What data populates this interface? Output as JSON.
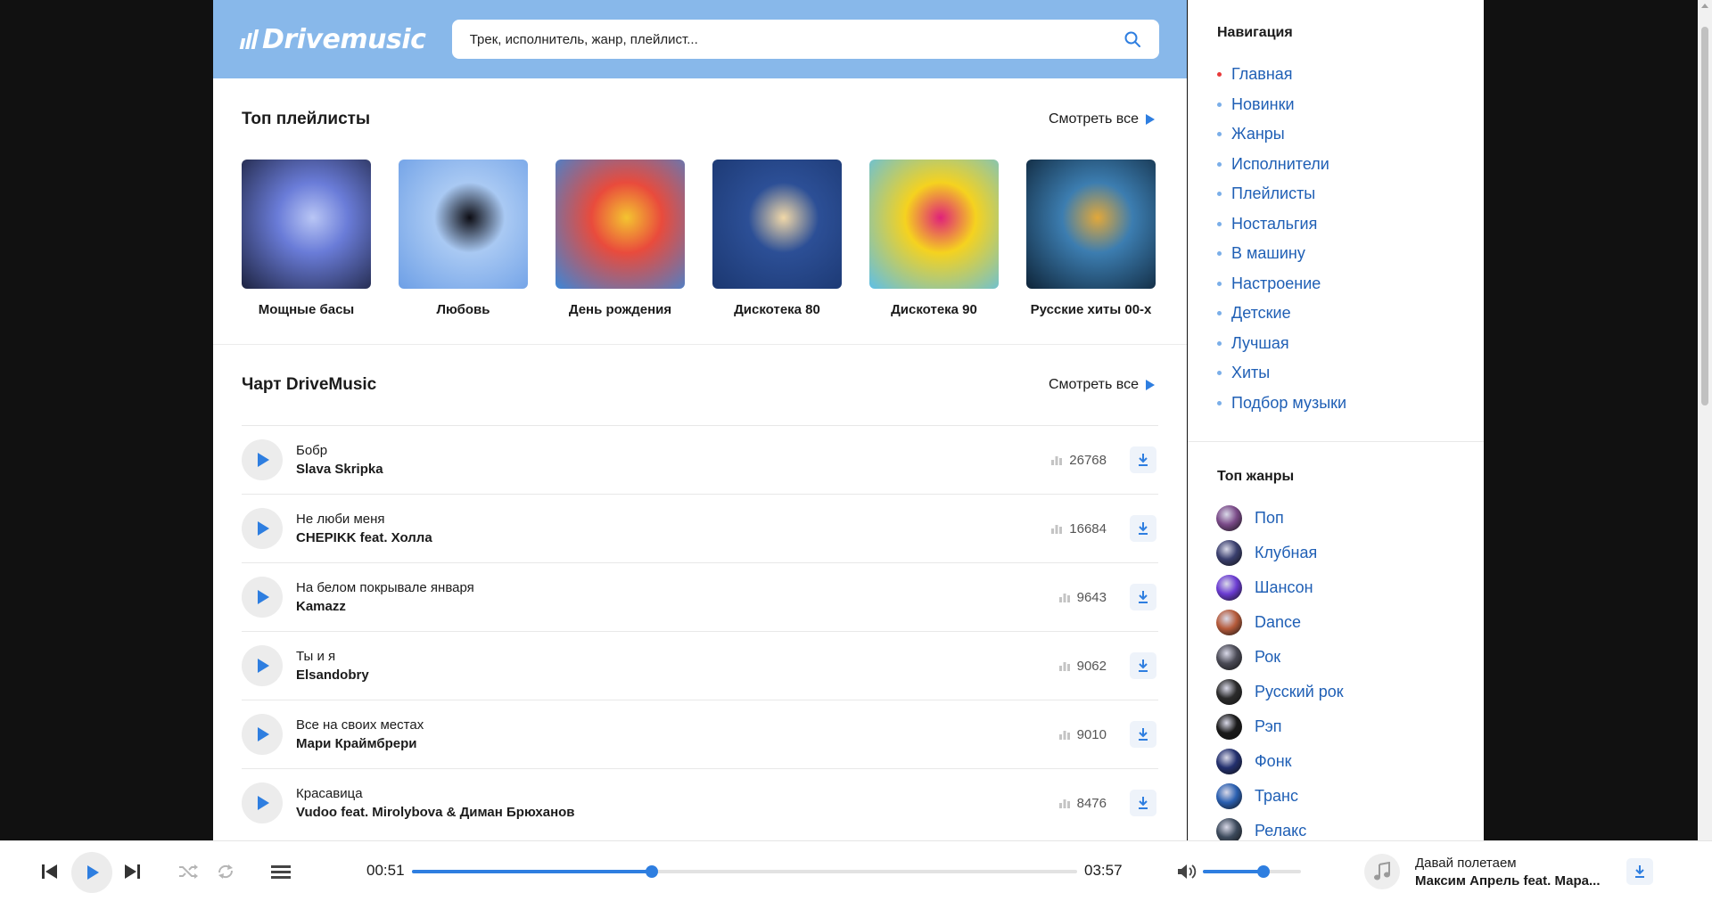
{
  "header": {
    "logo_text": "Drivemusic",
    "search_placeholder": "Трек, исполнитель, жанр, плейлист..."
  },
  "top_playlists": {
    "title": "Топ плейлисты",
    "see_all": "Смотреть все",
    "items": [
      {
        "title": "Мощные басы",
        "colors": [
          "#1d2340",
          "#6a7cd8",
          "#b9c6f5"
        ]
      },
      {
        "title": "Любовь",
        "colors": [
          "#6d9fe6",
          "#a9c9f3",
          "#0d0d14"
        ]
      },
      {
        "title": "День рождения",
        "colors": [
          "#3b86d8",
          "#e94b3c",
          "#f4c430"
        ]
      },
      {
        "title": "Дискотека 80",
        "colors": [
          "#1b3770",
          "#2c4f96",
          "#f1d8a8"
        ]
      },
      {
        "title": "Дискотека 90",
        "colors": [
          "#5dbfe8",
          "#f5d21f",
          "#e0227a"
        ]
      },
      {
        "title": "Русские хиты 00-х",
        "colors": [
          "#0e2438",
          "#3c7db0",
          "#e2a83a"
        ]
      }
    ]
  },
  "chart": {
    "title": "Чарт DriveMusic",
    "see_all": "Смотреть все",
    "tracks": [
      {
        "title": "Бобр",
        "artist": "Slava Skripka",
        "plays": "26768"
      },
      {
        "title": "Не люби меня",
        "artist": "CHEPIKK feat. Холла",
        "plays": "16684"
      },
      {
        "title": "На белом покрывале января",
        "artist": "Kamazz",
        "plays": "9643"
      },
      {
        "title": "Ты и я",
        "artist": "Elsandobry",
        "plays": "9062"
      },
      {
        "title": "Все на своих местах",
        "artist": "Мари Краймбрери",
        "plays": "9010"
      },
      {
        "title": "Красавица",
        "artist": "Vudoo feat. Mirolybova & Диман Брюханов",
        "plays": "8476"
      }
    ]
  },
  "sidebar": {
    "nav_title": "Навигация",
    "nav_items": [
      "Главная",
      "Новинки",
      "Жанры",
      "Исполнители",
      "Плейлисты",
      "Ностальгия",
      "В машину",
      "Настроение",
      "Детские",
      "Лучшая",
      "Хиты",
      "Подбор музыки"
    ],
    "active_nav": "Главная",
    "genres_title": "Топ жанры",
    "genres": [
      {
        "label": "Поп",
        "color": "#7a4a88"
      },
      {
        "label": "Клубная",
        "color": "#3a3f6e"
      },
      {
        "label": "Шансон",
        "color": "#6a3bd1"
      },
      {
        "label": "Dance",
        "color": "#b55a3a"
      },
      {
        "label": "Рок",
        "color": "#4a4a55"
      },
      {
        "label": "Русский рок",
        "color": "#2b2b2b"
      },
      {
        "label": "Рэп",
        "color": "#1a1a1a"
      },
      {
        "label": "Фонк",
        "color": "#23306e"
      },
      {
        "label": "Транс",
        "color": "#2a5fb0"
      },
      {
        "label": "Релакс",
        "color": "#3c4a5c"
      }
    ]
  },
  "player": {
    "current_time": "00:51",
    "total_time": "03:57",
    "progress_fraction": 0.36,
    "volume_fraction": 0.62,
    "now_title": "Давай полетаем",
    "now_artist": "Максим Апрель feat. Мара..."
  },
  "colors": {
    "accent": "#2e7ee0",
    "header_bg": "#88b8ea",
    "link": "#1f5fb5"
  }
}
